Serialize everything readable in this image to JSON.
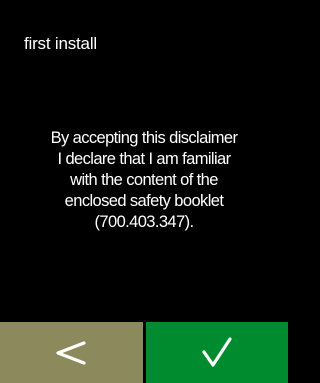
{
  "header": {
    "title": "first install"
  },
  "disclaimer": {
    "lines": [
      "By accepting this disclaimer",
      "I declare that I am familiar",
      "with the content of the",
      "enclosed safety booklet",
      "(700.403.347)."
    ]
  },
  "buttons": {
    "back": {
      "icon": "chevron-left-icon",
      "color": "#8c8a5c"
    },
    "confirm": {
      "icon": "checkmark-icon",
      "color": "#008b2e"
    }
  },
  "colors": {
    "background": "#000000",
    "text": "#ffffff"
  }
}
